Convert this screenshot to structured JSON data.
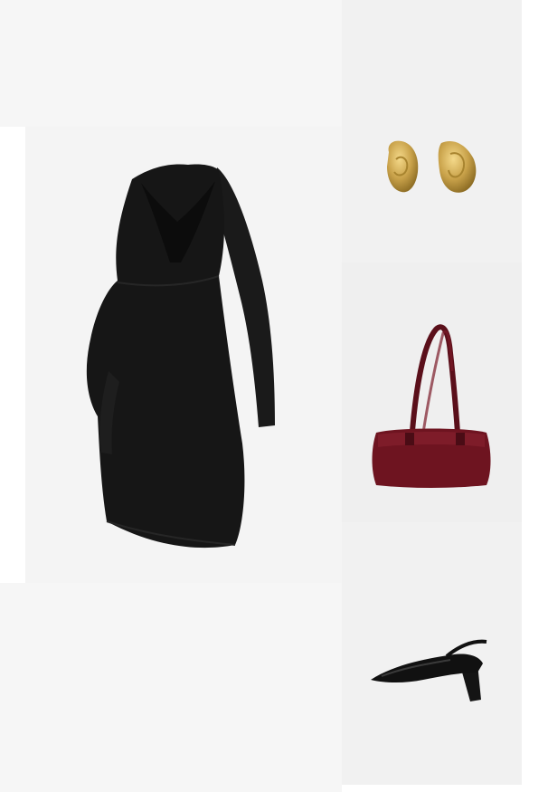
{
  "colors": {
    "background": "#ffffff",
    "panel_light": "#f6f6f6",
    "dress": "#151515",
    "gold": "#c9a24a",
    "bag": "#6e1420",
    "shoe": "#111111"
  },
  "items": [
    {
      "icon": "dress-icon"
    },
    {
      "icon": "earrings-icon"
    },
    {
      "icon": "handbag-icon"
    },
    {
      "icon": "slingback-shoe-icon"
    }
  ]
}
